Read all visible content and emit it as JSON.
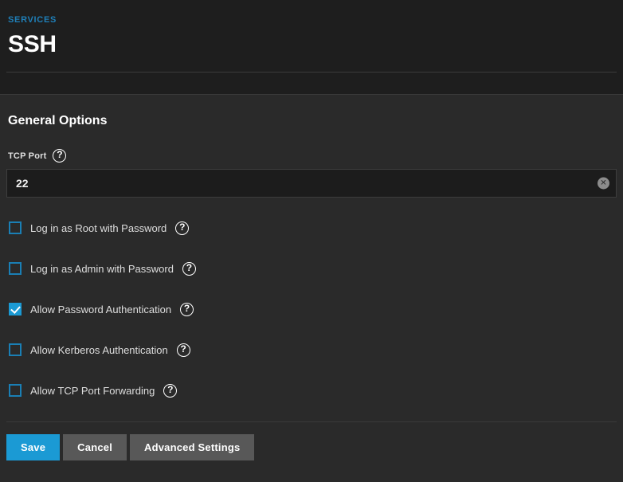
{
  "header": {
    "breadcrumb": "SERVICES",
    "title": "SSH"
  },
  "card": {
    "title": "General Options"
  },
  "tcp_port": {
    "label": "TCP Port",
    "value": "22",
    "placeholder": "",
    "help_icon": "question-circle-icon",
    "clear_icon": "clear-circle-icon"
  },
  "checkboxes": [
    {
      "label": "Log in as Root with Password",
      "checked": false,
      "help_icon": "question-circle-icon"
    },
    {
      "label": "Log in as Admin with Password",
      "checked": false,
      "help_icon": "question-circle-icon"
    },
    {
      "label": "Allow Password Authentication",
      "checked": true,
      "help_icon": "question-circle-icon"
    },
    {
      "label": "Allow Kerberos Authentication",
      "checked": false,
      "help_icon": "question-circle-icon"
    },
    {
      "label": "Allow TCP Port Forwarding",
      "checked": false,
      "help_icon": "question-circle-icon"
    }
  ],
  "buttons": {
    "save": "Save",
    "cancel": "Cancel",
    "advanced": "Advanced Settings"
  },
  "colors": {
    "accent": "#1b9ad4",
    "breadcrumb": "#1f7fb8",
    "page_bg": "#1e1e1e",
    "card_bg": "#2a2a2a",
    "button_default": "#585858"
  }
}
